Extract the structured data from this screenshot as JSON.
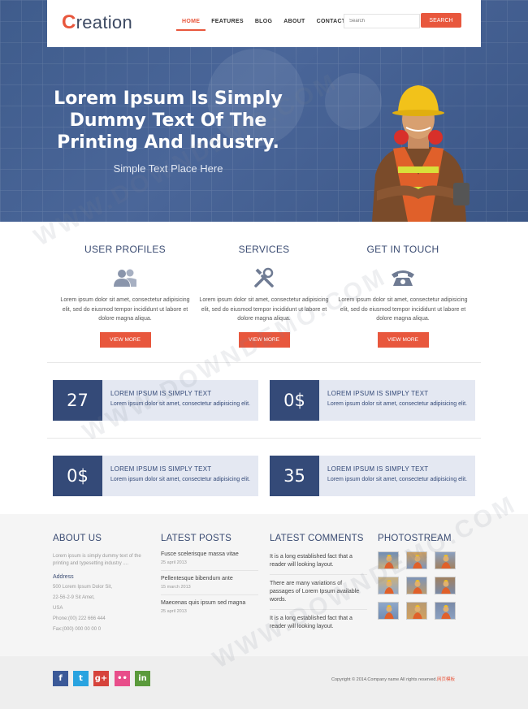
{
  "brand": {
    "logo_first": "C",
    "logo_rest": "reation"
  },
  "nav": {
    "items": [
      "HOME",
      "FEATURES",
      "BLOG",
      "ABOUT",
      "CONTACT"
    ],
    "active": "HOME"
  },
  "search": {
    "placeholder": "Search",
    "button": "SEARCH"
  },
  "hero": {
    "headline": "Lorem Ipsum Is Simply Dummy Text Of The Printing And Industry.",
    "subtitle": "Simple Text Place Here"
  },
  "features": [
    {
      "title": "USER PROFILES",
      "icon": "users-icon",
      "text": "Lorem ipsum dolor sit amet, consectetur adipisicing elit, sed do eiusmod tempor incididunt ut labore et dolore magna aliqua.",
      "button": "VIEW MORE"
    },
    {
      "title": "SERVICES",
      "icon": "tools-icon",
      "text": "Lorem ipsum dolor sit amet, consectetur adipisicing elit, sed do eiusmod tempor incididunt ut labore et dolore magna aliqua.",
      "button": "VIEW MORE"
    },
    {
      "title": "GET IN TOUCH",
      "icon": "phone-icon",
      "text": "Lorem ipsum dolor sit amet, consectetur adipisicing elit, sed do eiusmod tempor incididunt ut labore et dolore magna aliqua.",
      "button": "VIEW MORE"
    }
  ],
  "stats": [
    {
      "number": "27",
      "title": "LOREM IPSUM IS SIMPLY TEXT",
      "text": "Lorem ipsum dolor sit amet, consectetur adipisicing elit."
    },
    {
      "number": "0$",
      "title": "LOREM IPSUM IS SIMPLY TEXT",
      "text": "Lorem ipsum dolor sit amet, consectetur adipisicing elit."
    },
    {
      "number": "0$",
      "title": "LOREM IPSUM IS SIMPLY TEXT",
      "text": "Lorem ipsum dolor sit amet, consectetur adipisicing elit."
    },
    {
      "number": "35",
      "title": "LOREM IPSUM IS SIMPLY TEXT",
      "text": "Lorem ipsum dolor sit amet, consectetur adipisicing elit."
    }
  ],
  "about": {
    "title": "ABOUT US",
    "text": "Lorem ipsum is simply dummy text of the printing and typesetting industry ....",
    "address_label": "Address",
    "lines": [
      "500 Lorem Ipsum Dolor Sit,",
      "22-56-2-9 Sit Amet,",
      "USA",
      "Phone:(00) 222 666 444",
      "Fax:(000) 000 00 00 0"
    ]
  },
  "latest_posts": {
    "title": "LATEST POSTS",
    "items": [
      {
        "title": "Fusce scelerisque massa vitae",
        "date": "25 april 2013"
      },
      {
        "title": "Pellentesque bibendum ante",
        "date": "15 march 2013"
      },
      {
        "title": "Maecenas quis ipsum sed magna",
        "date": "25 april 2013"
      }
    ]
  },
  "latest_comments": {
    "title": "LATEST COMMENTS",
    "items": [
      "It is a long established fact that a reader will looking layout.",
      "There are many variations of passages of Lorem Ipsum available words.",
      "It is a long established fact that a reader will looking layout."
    ]
  },
  "photostream": {
    "title": "PHOTOSTREAM",
    "count": 9
  },
  "social": [
    {
      "icon": "facebook-icon",
      "glyph": "f",
      "color": "#3b5998"
    },
    {
      "icon": "twitter-icon",
      "glyph": "t",
      "color": "#29a3e0"
    },
    {
      "icon": "googleplus-icon",
      "glyph": "g+",
      "color": "#d6433b"
    },
    {
      "icon": "flickr-icon",
      "glyph": "••",
      "color": "#e84d8a"
    },
    {
      "icon": "linkedin-icon",
      "glyph": "in",
      "color": "#5a9a3b"
    }
  ],
  "copyright": {
    "text": "Copyright © 2014.Company name All rights reserved.",
    "link": "网页模板"
  },
  "watermark": "WWW.DOWNDEMO.COM",
  "colors": {
    "accent": "#e8573d",
    "navy": "#344a78",
    "panel": "#e4e8f2"
  }
}
